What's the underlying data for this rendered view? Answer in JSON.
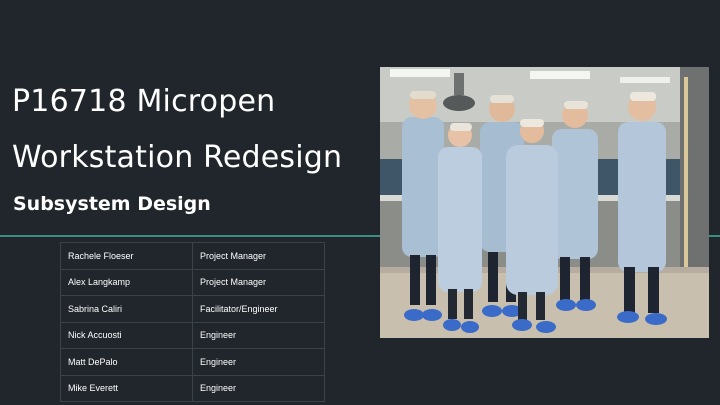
{
  "slide": {
    "title_line1": "P16718 Micropen",
    "title_line2": "Workstation Redesign",
    "subtitle": "Subsystem Design",
    "accent_color": "#3a8f80",
    "background_color": "#20262b"
  },
  "team": [
    {
      "name": "Rachele Floeser",
      "role": "Project Manager"
    },
    {
      "name": "Alex Langkamp",
      "role": "Project Manager"
    },
    {
      "name": "Sabrina Caliri",
      "role": "Facilitator/Engineer"
    },
    {
      "name": "Nick Accuosti",
      "role": "Engineer"
    },
    {
      "name": "Matt DePalo",
      "role": "Engineer"
    },
    {
      "name": "Mike Everett",
      "role": "Engineer"
    }
  ],
  "photo": {
    "subject": "team-photo-cleanroom"
  }
}
